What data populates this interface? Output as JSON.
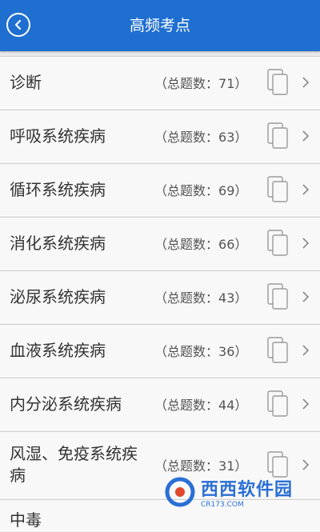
{
  "header": {
    "title": "高频考点"
  },
  "items": [
    {
      "title": "诊断",
      "count_label": "总题数：71"
    },
    {
      "title": "呼吸系统疾病",
      "count_label": "总题数：63"
    },
    {
      "title": "循环系统疾病",
      "count_label": "总题数：69"
    },
    {
      "title": "消化系统疾病",
      "count_label": "总题数：66"
    },
    {
      "title": "泌尿系统疾病",
      "count_label": "总题数：43"
    },
    {
      "title": "血液系统疾病",
      "count_label": "总题数：36"
    },
    {
      "title": "内分泌系统疾病",
      "count_label": "总题数：44"
    },
    {
      "title": "风湿、免疫系统疾病",
      "count_label": "总题数：31"
    },
    {
      "title": "中毒",
      "count_label": ""
    }
  ],
  "watermark": {
    "brand": "西西软件园",
    "url": "CR173.COM"
  }
}
